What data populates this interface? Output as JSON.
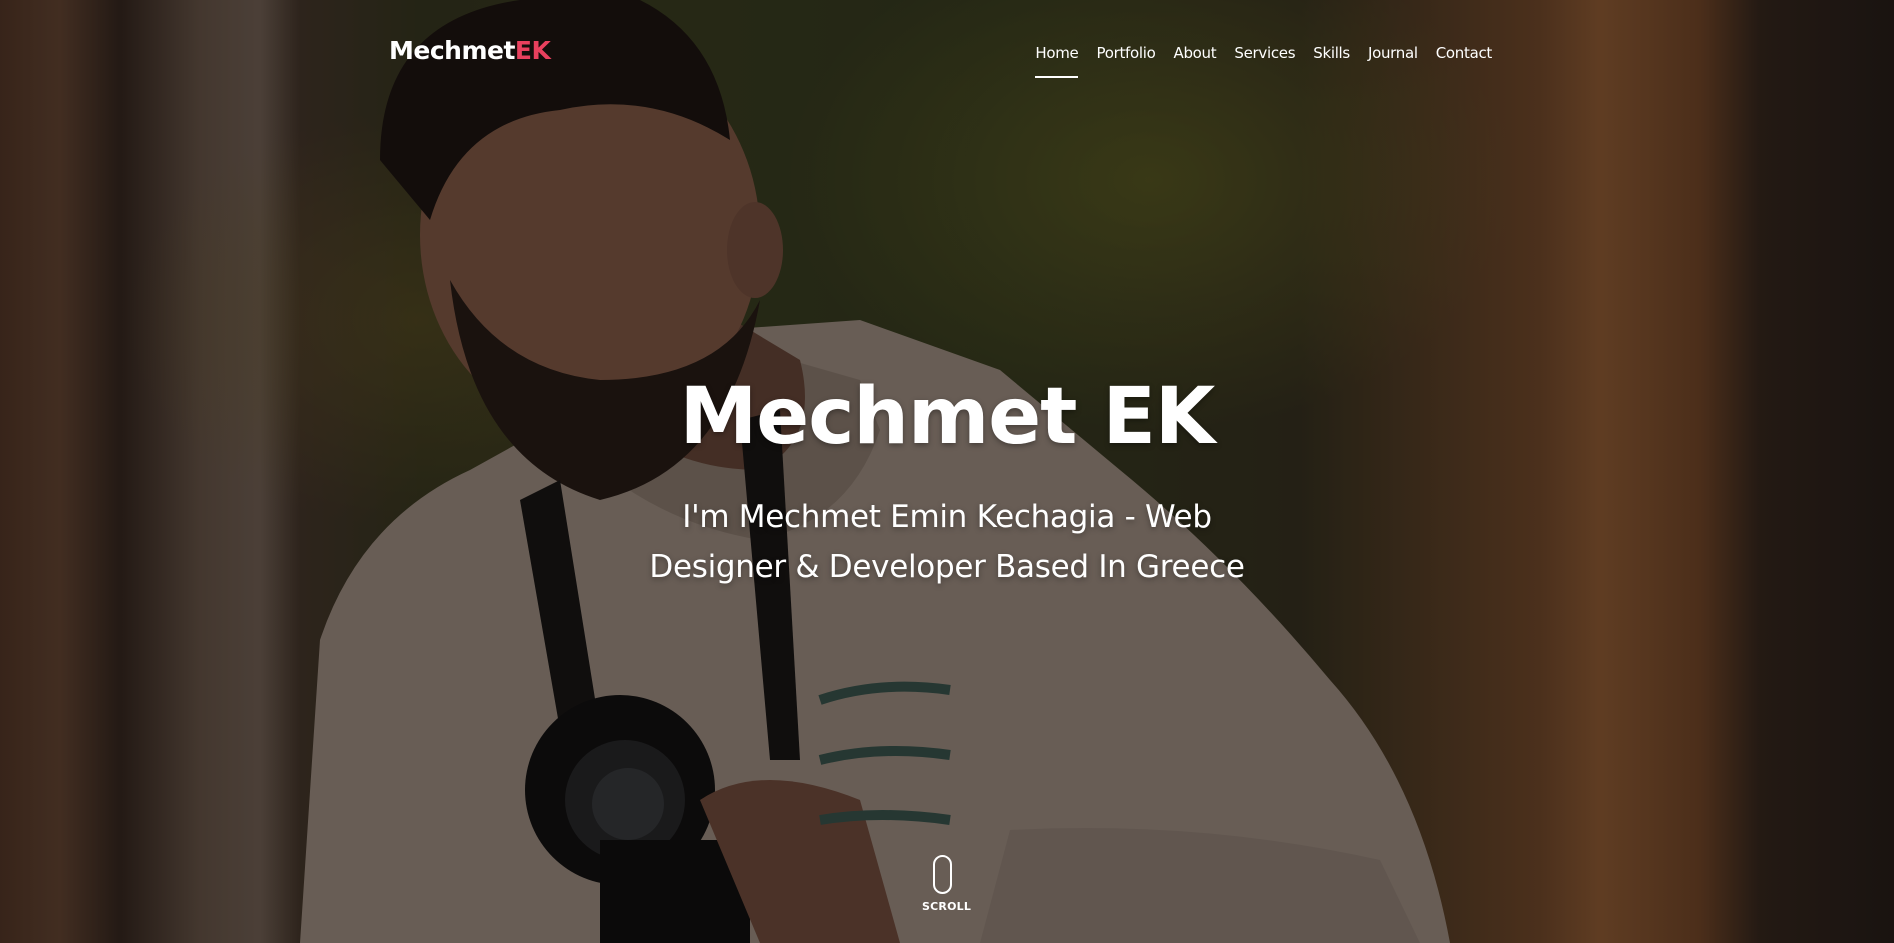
{
  "brand": {
    "logo_main": "Mechmet",
    "logo_accent": "EK",
    "accent_color": "#e8405e"
  },
  "nav": {
    "items": [
      {
        "label": "Home",
        "active": true
      },
      {
        "label": "Portfolio",
        "active": false
      },
      {
        "label": "About",
        "active": false
      },
      {
        "label": "Services",
        "active": false
      },
      {
        "label": "Skills",
        "active": false
      },
      {
        "label": "Journal",
        "active": false
      },
      {
        "label": "Contact",
        "active": false
      }
    ]
  },
  "hero": {
    "title": "Mechmet EK",
    "subtitle": "I'm Mechmet Emin Kechagia - Web Designer & Developer Based In Greece",
    "background": "photo-man-with-camera"
  },
  "scroll": {
    "label": "SCROLL",
    "icon": "mouse-icon"
  }
}
